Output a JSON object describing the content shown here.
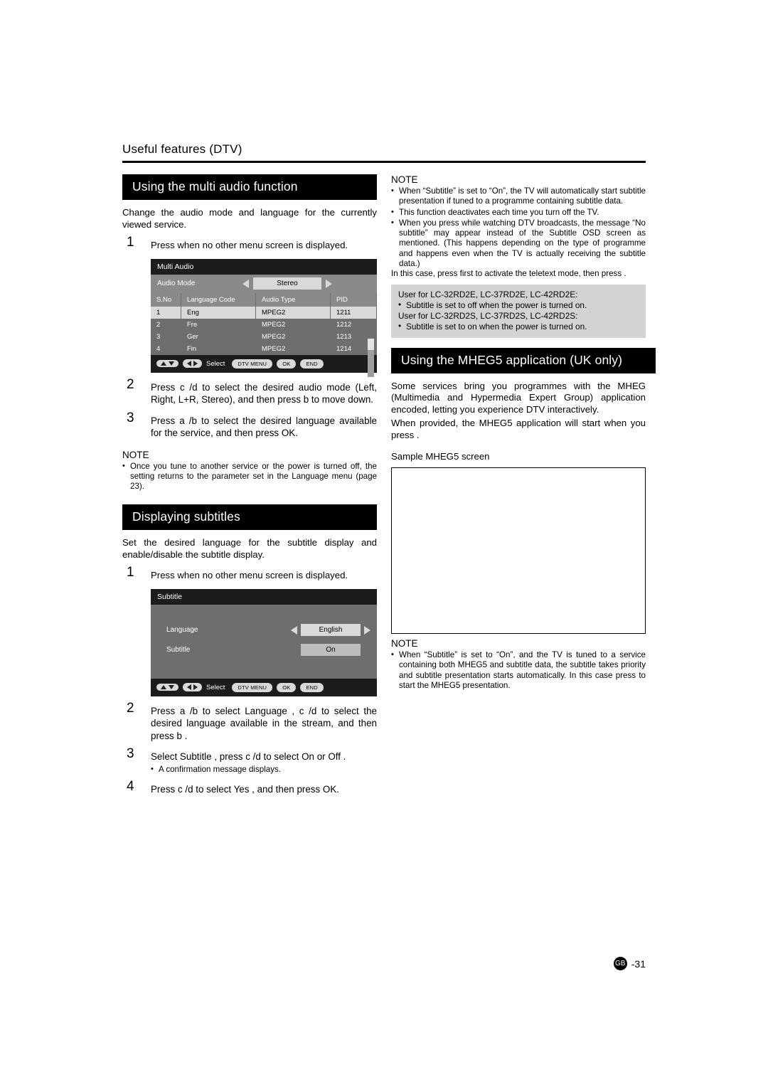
{
  "header": {
    "breadcrumb": "Useful features (DTV)"
  },
  "left": {
    "section1_title": "Using the multi audio function",
    "intro": "Change the audio mode and language for the currently viewed service.",
    "step1": {
      "num": "1",
      "text": "Press        when no other menu screen is displayed."
    },
    "osd_multi_audio": {
      "title": "Multi Audio",
      "audio_mode_label": "Audio Mode",
      "audio_mode_value": "Stereo",
      "columns": [
        "S.No",
        "Language Code",
        "Audio Type",
        "PID"
      ],
      "rows": [
        {
          "sno": "1",
          "lang": "Eng",
          "type": "MPEG2",
          "pid": "1211"
        },
        {
          "sno": "2",
          "lang": "Fre",
          "type": "MPEG2",
          "pid": "1212"
        },
        {
          "sno": "3",
          "lang": "Ger",
          "type": "MPEG2",
          "pid": "1213"
        },
        {
          "sno": "4",
          "lang": "Fin",
          "type": "MPEG2",
          "pid": "1214"
        }
      ],
      "footer": {
        "select": "Select",
        "dtv_menu": "DTV MENU",
        "ok": "OK",
        "end": "END"
      }
    },
    "step2": {
      "num": "2",
      "text": "Press c /d to select the desired audio mode (Left, Right, L+R, Stereo), and then press b  to move down."
    },
    "step3": {
      "num": "3",
      "text": "Press  a /b  to  select  the  desired  language available for the service, and then press OK."
    },
    "note_title": "NOTE",
    "note_items": [
      "Once you tune to another service or the power is turned off, the setting returns to the parameter set in the Language menu (page 23)."
    ],
    "section2_title": "Displaying subtitles",
    "intro2": "Set the desired language for the subtitle display and enable/disable the subtitle display.",
    "step1b": {
      "num": "1",
      "text": "Press        when no other menu screen is displayed."
    },
    "osd_subtitle": {
      "title": "Subtitle",
      "language_label": "Language",
      "language_value": "English",
      "subtitle_label": "Subtitle",
      "subtitle_value": "On",
      "footer": {
        "select": "Select",
        "dtv_menu": "DTV MENU",
        "ok": "OK",
        "end": "END"
      }
    },
    "step2b": {
      "num": "2",
      "text": "Press a /b  to select  Language , c /d  to select the desired language available in the stream, and then press b ."
    },
    "step3b": {
      "num": "3",
      "text": "Select  Subtitle , press c /d  to select  On  or  Off ."
    },
    "step3b_note": "A confirmation message displays.",
    "step4b": {
      "num": "4",
      "text": "Press c /d  to select  Yes , and then press OK."
    }
  },
  "right": {
    "note_title": "NOTE",
    "note_items": [
      "When “Subtitle” is set to “On”, the TV will automatically start subtitle presentation if tuned to a programme containing subtitle data.",
      "This function deactivates each time you turn off the TV.",
      "When you press        while watching DTV broadcasts, the message “No subtitle” may appear instead of the Subtitle OSD screen as mentioned. (This happens depending on the type of programme and happens even when the TV is actually receiving the subtitle data.)"
    ],
    "note_tail": "In this case, press        first to activate the teletext mode, then press        .",
    "greybox": {
      "line1": "User for LC-32RD2E, LC-37RD2E, LC-42RD2E:",
      "bullet1": "Subtitle is set to off when the power is turned on.",
      "line2": "User for LC-32RD2S, LC-37RD2S, LC-42RD2S:",
      "bullet2": "Subtitle is set to on when the power is turned on."
    },
    "section_title": "Using the MHEG5 application (UK only)",
    "para1": "Some services bring you programmes with the MHEG (Multimedia and Hypermedia Expert Group) application encoded, letting you experience DTV interactively.",
    "para2": "When provided, the MHEG5 application will start when you press        .",
    "sample_label": "Sample MHEG5 screen",
    "note2_title": "NOTE",
    "note2_items": [
      "When “Subtitle” is set to “On”, and the TV is tuned to a service containing both MHEG5 and subtitle data, the subtitle takes priority and subtitle presentation starts automatically. In this case press        to start the MHEG5 presentation."
    ]
  },
  "footer": {
    "badge": "GB",
    "page": "-31"
  }
}
